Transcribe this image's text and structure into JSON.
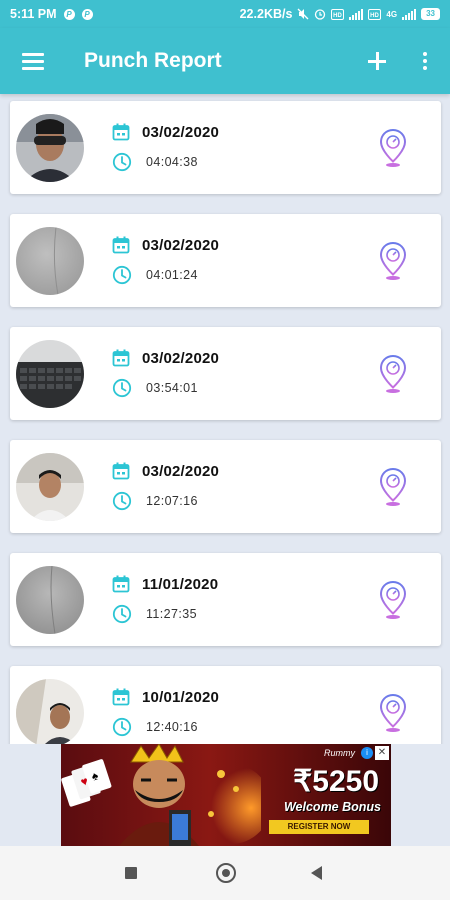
{
  "status_bar": {
    "time": "5:11 PM",
    "speed": "22.2KB/s",
    "network": "4G",
    "battery": "33"
  },
  "app_bar": {
    "title": "Punch Report",
    "icons": [
      "menu-icon",
      "add-icon",
      "more-vert-icon"
    ]
  },
  "records": [
    {
      "date": "03/02/2020",
      "time": "04:04:38"
    },
    {
      "date": "03/02/2020",
      "time": "04:01:24"
    },
    {
      "date": "03/02/2020",
      "time": "03:54:01"
    },
    {
      "date": "03/02/2020",
      "time": "12:07:16"
    },
    {
      "date": "11/01/2020",
      "time": "11:27:35"
    },
    {
      "date": "10/01/2020",
      "time": "12:40:16"
    }
  ],
  "ad": {
    "brand": "Rummy",
    "amount": "₹5250",
    "bonus": "Welcome Bonus",
    "register": "REGISTER NOW"
  },
  "colors": {
    "primary": "#3fc0cf",
    "icon_teal": "#2cc5d4",
    "location_purple": "#b56fe0",
    "location_blue": "#6a7bea"
  }
}
